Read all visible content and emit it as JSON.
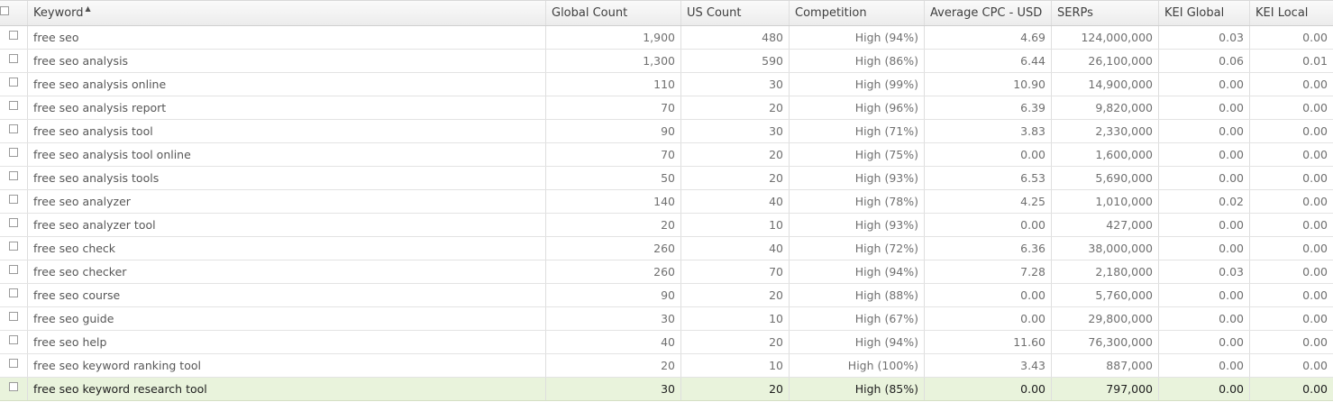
{
  "columns": {
    "keyword": "Keyword",
    "global_count": "Global Count",
    "us_count": "US Count",
    "competition": "Competition",
    "avg_cpc": "Average CPC - USD",
    "serps": "SERPs",
    "kei_global": "KEI Global",
    "kei_local": "KEI Local",
    "sort_indicator": "▲"
  },
  "rows": [
    {
      "keyword": "free seo",
      "global": "1,900",
      "us": "480",
      "competition": "High (94%)",
      "cpc": "4.69",
      "serps": "124,000,000",
      "kei_global": "0.03",
      "kei_local": "0.00"
    },
    {
      "keyword": "free seo analysis",
      "global": "1,300",
      "us": "590",
      "competition": "High (86%)",
      "cpc": "6.44",
      "serps": "26,100,000",
      "kei_global": "0.06",
      "kei_local": "0.01"
    },
    {
      "keyword": "free seo analysis online",
      "global": "110",
      "us": "30",
      "competition": "High (99%)",
      "cpc": "10.90",
      "serps": "14,900,000",
      "kei_global": "0.00",
      "kei_local": "0.00"
    },
    {
      "keyword": "free seo analysis report",
      "global": "70",
      "us": "20",
      "competition": "High (96%)",
      "cpc": "6.39",
      "serps": "9,820,000",
      "kei_global": "0.00",
      "kei_local": "0.00"
    },
    {
      "keyword": "free seo analysis tool",
      "global": "90",
      "us": "30",
      "competition": "High (71%)",
      "cpc": "3.83",
      "serps": "2,330,000",
      "kei_global": "0.00",
      "kei_local": "0.00"
    },
    {
      "keyword": "free seo analysis tool online",
      "global": "70",
      "us": "20",
      "competition": "High (75%)",
      "cpc": "0.00",
      "serps": "1,600,000",
      "kei_global": "0.00",
      "kei_local": "0.00"
    },
    {
      "keyword": "free seo analysis tools",
      "global": "50",
      "us": "20",
      "competition": "High (93%)",
      "cpc": "6.53",
      "serps": "5,690,000",
      "kei_global": "0.00",
      "kei_local": "0.00"
    },
    {
      "keyword": "free seo analyzer",
      "global": "140",
      "us": "40",
      "competition": "High (78%)",
      "cpc": "4.25",
      "serps": "1,010,000",
      "kei_global": "0.02",
      "kei_local": "0.00"
    },
    {
      "keyword": "free seo analyzer tool",
      "global": "20",
      "us": "10",
      "competition": "High (93%)",
      "cpc": "0.00",
      "serps": "427,000",
      "kei_global": "0.00",
      "kei_local": "0.00"
    },
    {
      "keyword": "free seo check",
      "global": "260",
      "us": "40",
      "competition": "High (72%)",
      "cpc": "6.36",
      "serps": "38,000,000",
      "kei_global": "0.00",
      "kei_local": "0.00"
    },
    {
      "keyword": "free seo checker",
      "global": "260",
      "us": "70",
      "competition": "High (94%)",
      "cpc": "7.28",
      "serps": "2,180,000",
      "kei_global": "0.03",
      "kei_local": "0.00"
    },
    {
      "keyword": "free seo course",
      "global": "90",
      "us": "20",
      "competition": "High (88%)",
      "cpc": "0.00",
      "serps": "5,760,000",
      "kei_global": "0.00",
      "kei_local": "0.00"
    },
    {
      "keyword": "free seo guide",
      "global": "30",
      "us": "10",
      "competition": "High (67%)",
      "cpc": "0.00",
      "serps": "29,800,000",
      "kei_global": "0.00",
      "kei_local": "0.00"
    },
    {
      "keyword": "free seo help",
      "global": "40",
      "us": "20",
      "competition": "High (94%)",
      "cpc": "11.60",
      "serps": "76,300,000",
      "kei_global": "0.00",
      "kei_local": "0.00"
    },
    {
      "keyword": "free seo keyword ranking tool",
      "global": "20",
      "us": "10",
      "competition": "High (100%)",
      "cpc": "3.43",
      "serps": "887,000",
      "kei_global": "0.00",
      "kei_local": "0.00"
    },
    {
      "keyword": "free seo keyword research tool",
      "global": "30",
      "us": "20",
      "competition": "High (85%)",
      "cpc": "0.00",
      "serps": "797,000",
      "kei_global": "0.00",
      "kei_local": "0.00"
    }
  ],
  "selected_row_index": 15,
  "colors": {
    "selected_row_bg": "#e9f3dc",
    "header_text": "#3f3f3f",
    "body_text": "#707070"
  }
}
